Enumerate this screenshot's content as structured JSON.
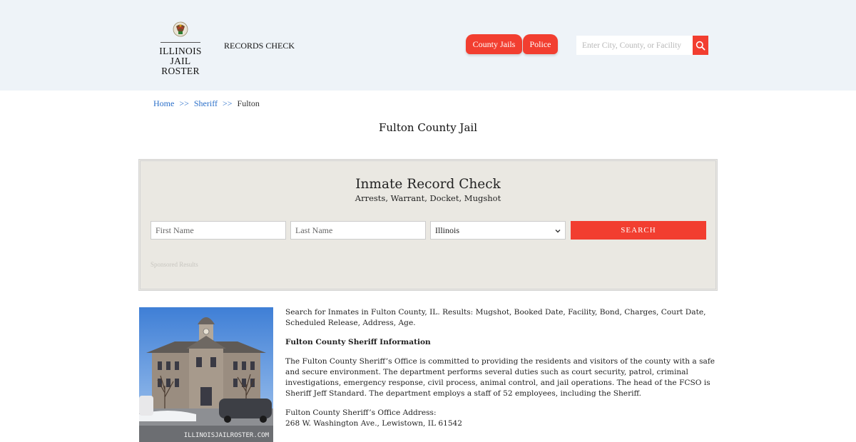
{
  "header": {
    "logo_line1": "ILLINOIS",
    "logo_line2": "JAIL ROSTER",
    "records_check": "RECORDS CHECK",
    "nav": [
      {
        "label": "County Jails"
      },
      {
        "label": "Police"
      }
    ],
    "search_placeholder": "Enter City, County, or Facility"
  },
  "breadcrumb": {
    "home": "Home",
    "sheriff": "Sheriff",
    "separator": ">>",
    "current": "Fulton"
  },
  "page_title": "Fulton County Jail",
  "record_check": {
    "title": "Inmate Record Check",
    "subtitle": "Arrests, Warrant, Docket, Mugshot",
    "first_name_placeholder": "First Name",
    "last_name_placeholder": "Last Name",
    "state_selected": "Illinois",
    "search_label": "SEARCH",
    "sponsored": "Sponsored Results"
  },
  "photo": {
    "watermark": "ILLINOISJAILROSTER.COM"
  },
  "content": {
    "intro": "Search for Inmates in Fulton County, IL. Results: Mugshot, Booked Date, Facility, Bond, Charges, Court Date, Scheduled Release, Address, Age.",
    "sheriff_heading": "Fulton County Sheriff Information",
    "sheriff_body": "The Fulton County Sheriff’s Office is committed to providing the residents and visitors of the county with a safe and secure environment. The department performs several duties such as court security, patrol, criminal investigations, emergency response, civil process, animal control, and jail operations. The head of the FCSO is Sheriff Jeff Standard. The department employs a staff of 52 employees, including the Sheriff.",
    "address_label": "Fulton County Sheriff’s Office Address:",
    "address_value": "268 W. Washington Ave., Lewistown, IL 61542"
  },
  "colors": {
    "accent": "#f23e30",
    "header_bg": "#eef3f8",
    "panel_bg": "#eae8e2",
    "link": "#2a6fc9"
  }
}
